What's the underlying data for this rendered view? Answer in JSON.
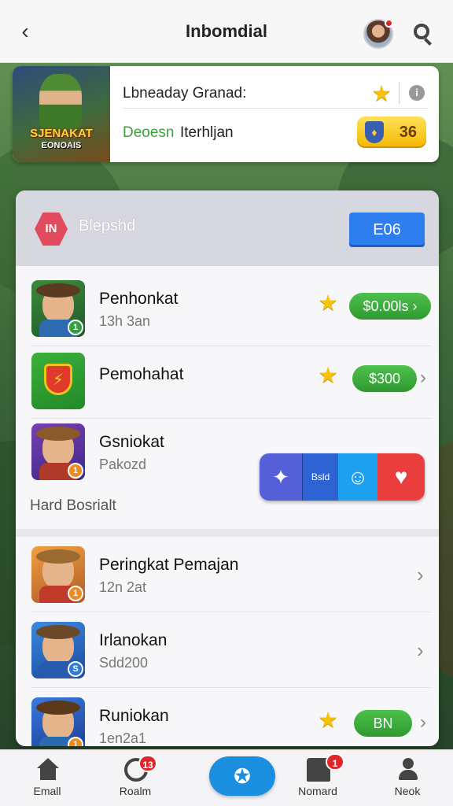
{
  "topbar": {
    "title": "Inbomdial",
    "back_icon": "‹"
  },
  "hero": {
    "art_title": "SJENAKAT",
    "art_subtitle": "EONOAIS",
    "row1_label": "Lbneaday Granad:",
    "row2_green": "Deoesn",
    "row2_dark": "Iterhljan",
    "coin_value": "36",
    "info_icon": "i"
  },
  "panel": {
    "badge_text": "IN",
    "title": "Blepshd",
    "action_button": "E06",
    "section_label": "Hard Bosrialt",
    "multi_button": {
      "seg2_label": "Bsld"
    }
  },
  "rows_top": [
    {
      "title": "Penhonkat",
      "subtitle": "13h 3an",
      "pill": "$0.00ls ›",
      "has_star": true,
      "badge": "1"
    },
    {
      "title": "Pemohahat",
      "subtitle": "",
      "pill": "$300",
      "has_star": true,
      "badge": ""
    },
    {
      "title": "Gsniokat",
      "subtitle": "Pakozd",
      "pill": "",
      "has_star": false,
      "badge": "1"
    }
  ],
  "rows_bottom": [
    {
      "title": "Peringkat Pemajan",
      "subtitle": "12n 2at",
      "badge": "1"
    },
    {
      "title": "Irlanokan",
      "subtitle": "Sdd200",
      "badge": "S"
    },
    {
      "title": "Runiokan",
      "subtitle": "1en2a1",
      "pill": "BN",
      "badge": "1"
    }
  ],
  "bottom_nav": [
    {
      "label": "Emall"
    },
    {
      "label": "Roalm",
      "badge": "13"
    },
    {
      "label": ""
    },
    {
      "label": "Nomard",
      "badge": "1"
    },
    {
      "label": "Neok"
    }
  ],
  "colors": {
    "accent_blue": "#2e7ef0",
    "pill_green": "#3aaa3a",
    "star_yellow": "#f7c20a",
    "badge_red": "#e0262b"
  }
}
